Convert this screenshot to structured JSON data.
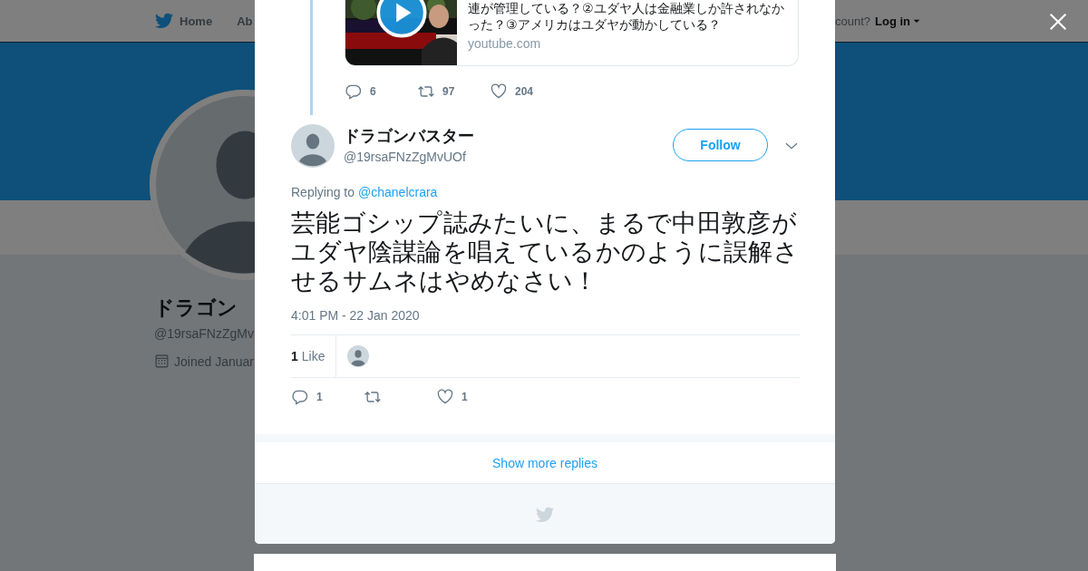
{
  "nav": {
    "items": [
      {
        "label": "Home"
      },
      {
        "label": "Ab"
      }
    ],
    "account_prompt": "count?",
    "login": "Log in"
  },
  "profile": {
    "name": "ドラゴン",
    "handle": "@19rsaFNzZgMv",
    "joined": "Joined Januar"
  },
  "modal": {
    "parent_tweet": {
      "card": {
        "description": "連が管理している？②ユダヤ人は金融業しか許されなかった？③アメリカはユダヤが動かしている？",
        "domain": "youtube.com"
      },
      "actions": [
        {
          "kind": "reply",
          "count": "6"
        },
        {
          "kind": "retweet",
          "count": "97"
        },
        {
          "kind": "like",
          "count": "204"
        }
      ]
    },
    "tweet": {
      "name": "ドラゴンバスター",
      "handle": "@19rsaFNzZgMvUOf",
      "follow_label": "Follow",
      "replying_to_label": "Replying to",
      "replying_to": "@chanelcrara",
      "text": "芸能ゴシップ誌みたいに、まるで中田敦彦がユダヤ陰謀論を唱えているかのように誤解させるサムネはやめなさい！",
      "timestamp": "4:01 PM - 22 Jan 2020",
      "likes_count": "1",
      "likes_label": "Like",
      "actions": [
        {
          "kind": "reply",
          "count": "1"
        },
        {
          "kind": "retweet"
        },
        {
          "kind": "like",
          "count": "1"
        }
      ]
    },
    "show_more": "Show more replies"
  }
}
